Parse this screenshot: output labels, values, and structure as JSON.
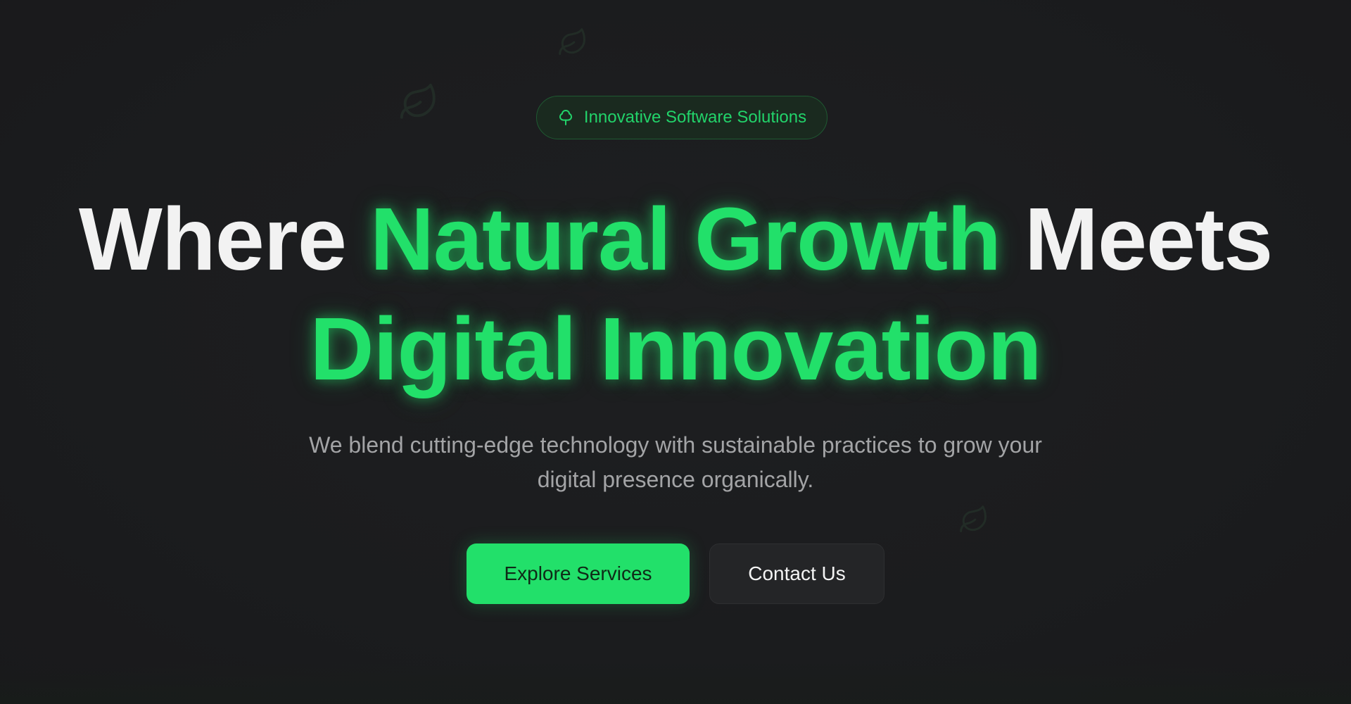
{
  "badge": {
    "icon": "tree-icon",
    "text": "Innovative Software Solutions"
  },
  "headline": {
    "part1": "Where ",
    "accent1": "Natural Growth",
    "part2": " Meets",
    "accent2": "Digital Innovation"
  },
  "subtitle": {
    "line1": "We blend cutting-edge technology with sustainable practices to grow your",
    "line2": "digital presence organically."
  },
  "buttons": {
    "primary_label": "Explore Services",
    "secondary_label": "Contact Us"
  },
  "decorations": {
    "icon": "leaf-icon"
  },
  "colors": {
    "background": "#1b1c1e",
    "accent": "#22e06a",
    "text": "#f2f2f2",
    "muted": "#a3a4a6"
  }
}
